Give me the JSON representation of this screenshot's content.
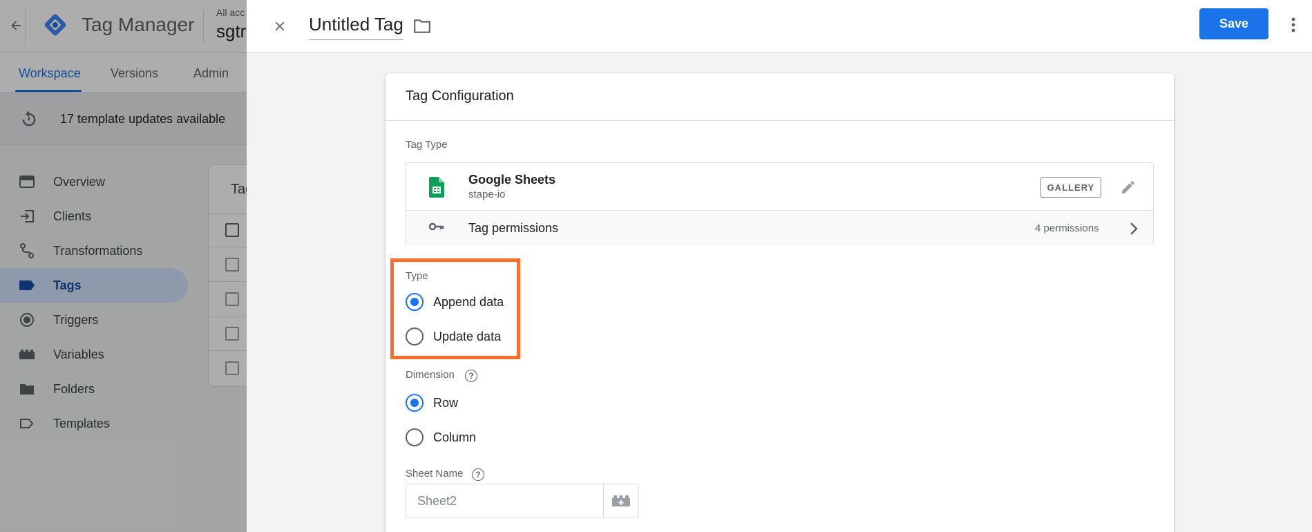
{
  "background": {
    "app_title": "Tag Manager",
    "account_small": "All acc",
    "account_big": "sgtr",
    "nav_tabs": [
      {
        "label": "Workspace",
        "active": true
      },
      {
        "label": "Versions",
        "active": false
      },
      {
        "label": "Admin",
        "active": false
      }
    ],
    "updates_text": "17 template updates available",
    "sidebar": {
      "items": [
        {
          "label": "Overview",
          "icon": "overview-icon"
        },
        {
          "label": "Clients",
          "icon": "clients-icon"
        },
        {
          "label": "Transformations",
          "icon": "transformations-icon"
        },
        {
          "label": "Tags",
          "icon": "tag-icon",
          "active": true
        },
        {
          "label": "Triggers",
          "icon": "triggers-icon"
        },
        {
          "label": "Variables",
          "icon": "variables-icon"
        },
        {
          "label": "Folders",
          "icon": "folder-icon"
        },
        {
          "label": "Templates",
          "icon": "templates-icon"
        }
      ]
    },
    "content_card_title": "Tag"
  },
  "sheet": {
    "tag_name": "Untitled Tag",
    "save_label": "Save"
  },
  "config": {
    "title": "Tag Configuration",
    "tag_type_label": "Tag Type",
    "tag_type_name": "Google Sheets",
    "tag_type_vendor": "stape-io",
    "gallery_badge": "GALLERY",
    "permissions_label": "Tag permissions",
    "permissions_count": "4 permissions",
    "type_label": "Type",
    "type_options": [
      "Append data",
      "Update data"
    ],
    "type_selected": "Append data",
    "dimension_label": "Dimension",
    "dimension_options": [
      "Row",
      "Column"
    ],
    "dimension_selected": "Row",
    "sheet_name_label": "Sheet Name",
    "sheet_name_value": "Sheet2"
  },
  "colors": {
    "accent": "#1a73e8",
    "highlight": "#ff6d2d",
    "sheets_green": "#0f9d58"
  }
}
